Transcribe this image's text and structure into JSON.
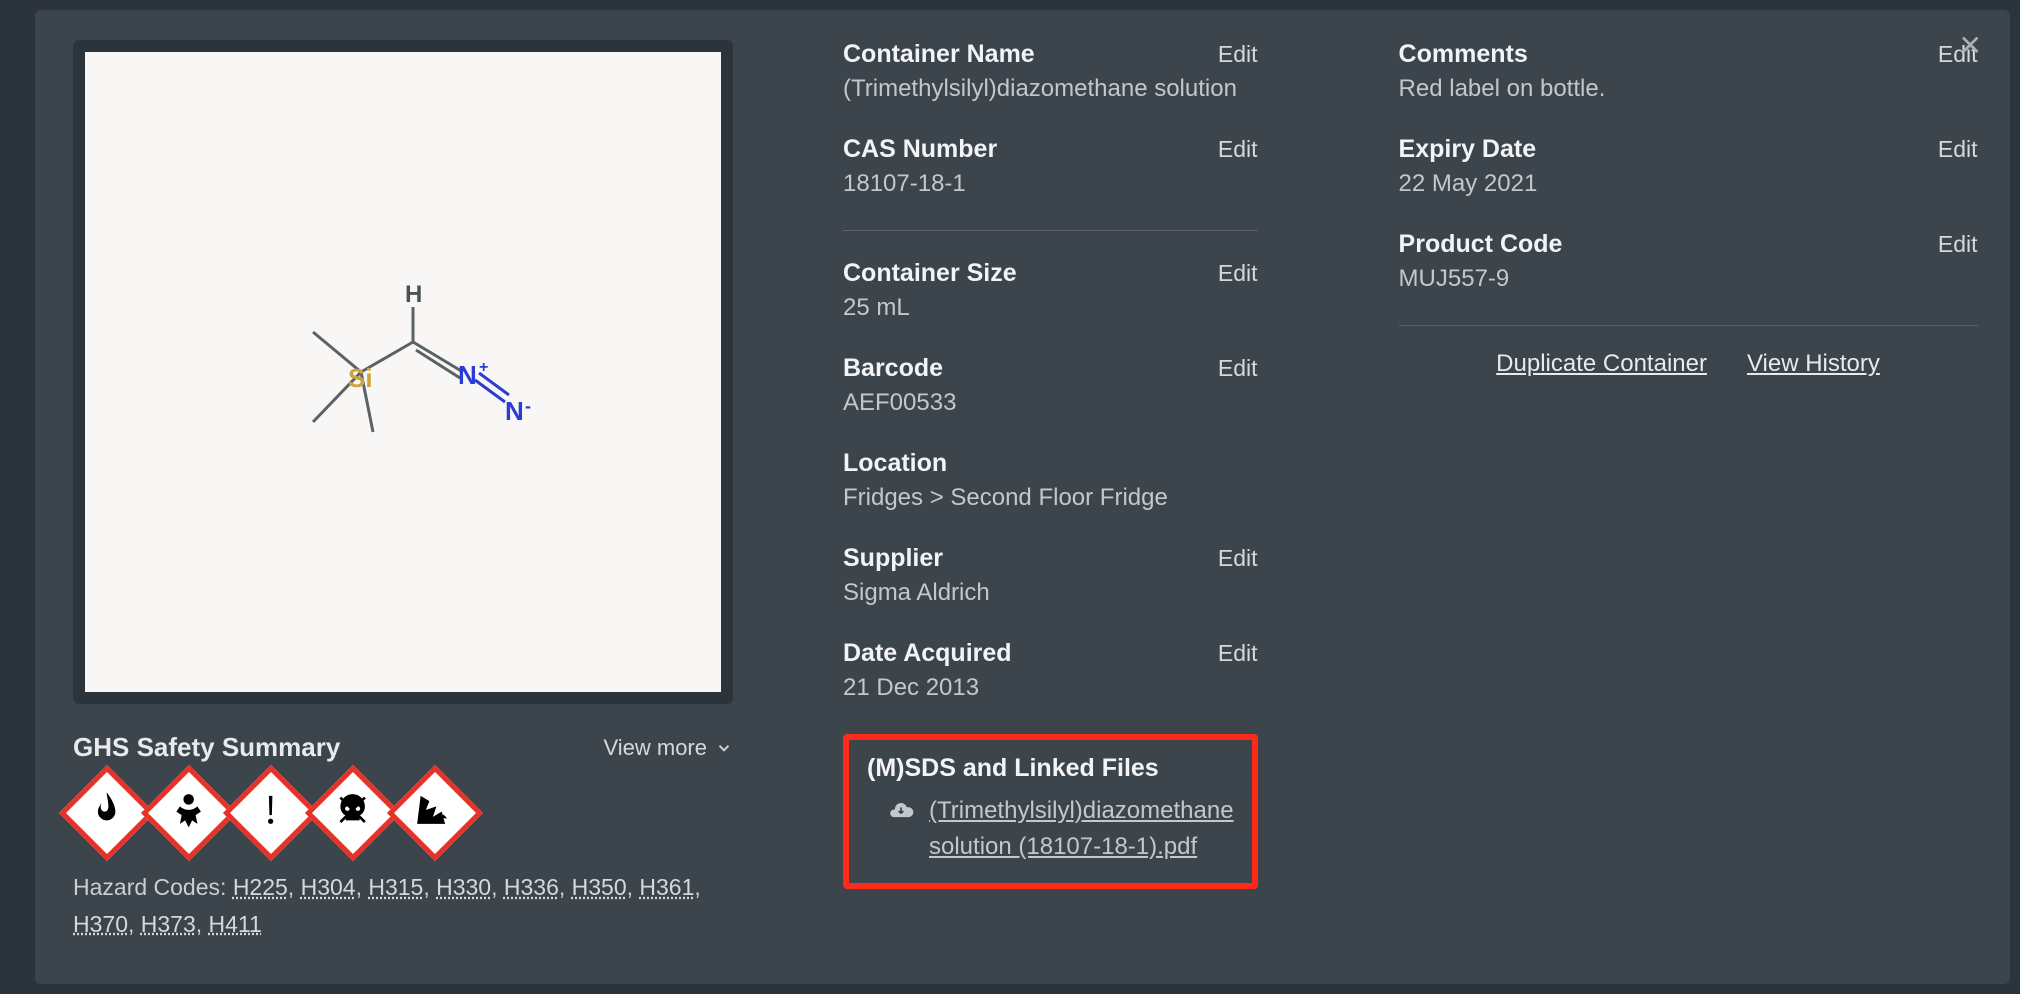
{
  "actions": {
    "edit": "Edit",
    "close": "✕",
    "view_more": "View more",
    "duplicate": "Duplicate Container",
    "history": "View History"
  },
  "ghs": {
    "title": "GHS Safety Summary",
    "hazard_label": "Hazard Codes:  ",
    "codes": [
      "H225",
      "H304",
      "H315",
      "H330",
      "H336",
      "H350",
      "H361",
      "H370",
      "H373",
      "H411"
    ]
  },
  "mid": {
    "container_name": {
      "label": "Container Name",
      "value": "(Trimethylsilyl)diazomethane solution"
    },
    "cas": {
      "label": "CAS Number",
      "value": "18107-18-1"
    },
    "size": {
      "label": "Container Size",
      "value": "25 mL"
    },
    "barcode": {
      "label": "Barcode",
      "value": "AEF00533"
    },
    "location": {
      "label": "Location",
      "value": "Fridges > Second Floor Fridge"
    },
    "supplier": {
      "label": "Supplier",
      "value": "Sigma Aldrich"
    },
    "acquired": {
      "label": "Date Acquired",
      "value": "21 Dec 2013"
    }
  },
  "msds": {
    "title": "(M)SDS and Linked Files",
    "file": "(Trimethylsilyl)diazomethane solution (18107-18-1).pdf"
  },
  "right": {
    "comments": {
      "label": "Comments",
      "value": "Red label on bottle."
    },
    "expiry": {
      "label": "Expiry Date",
      "value": "22 May 2021"
    },
    "product_code": {
      "label": "Product Code",
      "value": "MUJ557-9"
    }
  }
}
